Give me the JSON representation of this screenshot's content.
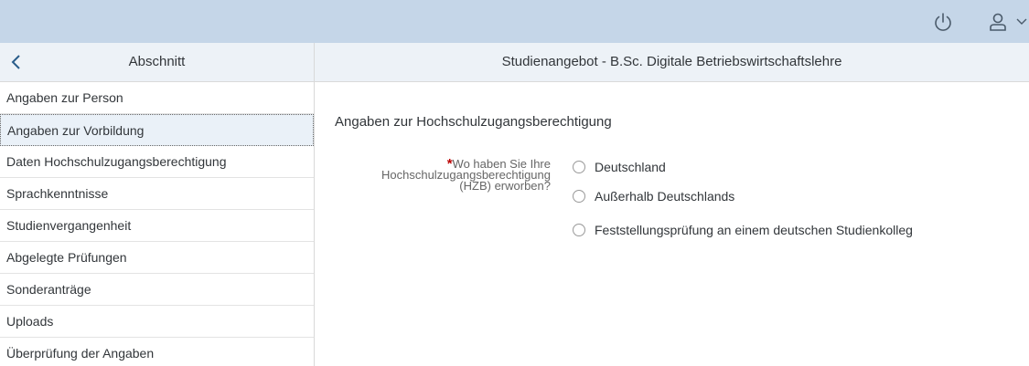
{
  "sidebar": {
    "title": "Abschnitt",
    "items": [
      {
        "label": "Angaben zur Person"
      },
      {
        "label": "Angaben zur Vorbildung"
      },
      {
        "label": "Daten Hochschulzugangsberechtigung"
      },
      {
        "label": "Sprachkenntnisse"
      },
      {
        "label": "Studienvergangenheit"
      },
      {
        "label": "Abgelegte Prüfungen"
      },
      {
        "label": "Sonderanträge"
      },
      {
        "label": "Uploads"
      },
      {
        "label": "Überprüfung der Angaben"
      }
    ]
  },
  "main": {
    "header": "Studienangebot - B.Sc. Digitale Betriebswirtschaftslehre",
    "section_title": "Angaben zur Hochschulzugangsberechtigung",
    "question": {
      "required_mark": "*",
      "line1": "Wo haben Sie Ihre",
      "line2": "Hochschulzugangsberechtigung",
      "line3": "(HZB) erworben?"
    },
    "options": [
      {
        "label": "Deutschland"
      },
      {
        "label": "Außerhalb Deutschlands"
      },
      {
        "label": "Feststellungsprüfung an einem deutschen Studienkolleg"
      }
    ]
  },
  "icons": {
    "power": "power-icon",
    "user": "user-icon",
    "back": "chevron-left-icon"
  },
  "colors": {
    "topbar": "#c5d6e8",
    "header": "#edf2f7",
    "selected": "#eaf1f8",
    "required": "#bb0000"
  }
}
